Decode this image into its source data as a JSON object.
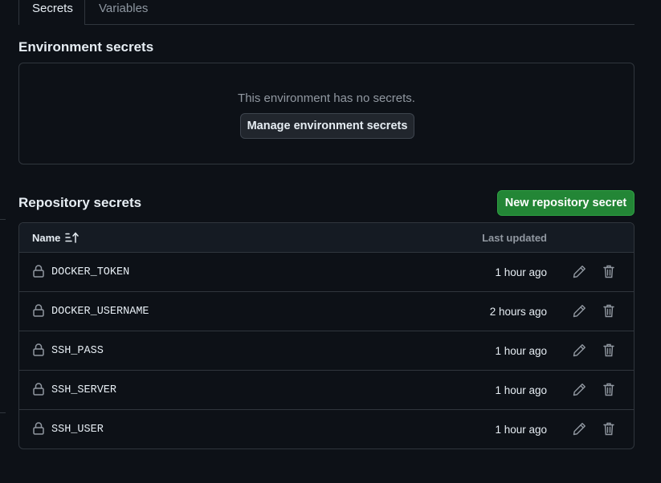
{
  "tabs": [
    {
      "label": "Secrets",
      "active": true
    },
    {
      "label": "Variables",
      "active": false
    }
  ],
  "environment": {
    "heading": "Environment secrets",
    "empty_message": "This environment has no secrets.",
    "manage_button": "Manage environment secrets"
  },
  "repository": {
    "heading": "Repository secrets",
    "new_button": "New repository secret",
    "columns": {
      "name": "Name",
      "updated": "Last updated"
    },
    "secrets": [
      {
        "name": "DOCKER_TOKEN",
        "updated": "1 hour ago"
      },
      {
        "name": "DOCKER_USERNAME",
        "updated": "2 hours ago"
      },
      {
        "name": "SSH_PASS",
        "updated": "1 hour ago"
      },
      {
        "name": "SSH_SERVER",
        "updated": "1 hour ago"
      },
      {
        "name": "SSH_USER",
        "updated": "1 hour ago"
      }
    ]
  },
  "icons": {
    "lock": "lock-icon",
    "edit": "pencil-icon",
    "delete": "trash-icon",
    "sort": "sort-ascending-icon"
  },
  "colors": {
    "background": "#0d1117",
    "primary_button": "#238636",
    "border": "#30363d",
    "muted_text": "#9198a1"
  }
}
